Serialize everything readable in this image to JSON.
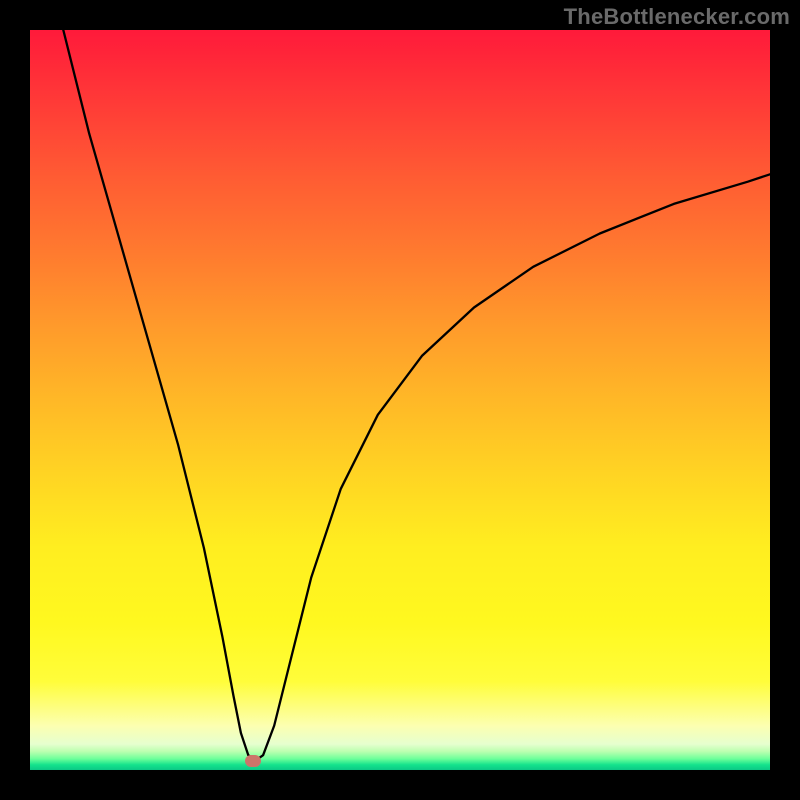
{
  "watermark": "TheBottlenecker.com",
  "marker": {
    "x_pct": 30.1,
    "y_pct": 98.8
  },
  "chart_data": {
    "type": "line",
    "title": "",
    "xlabel": "",
    "ylabel": "",
    "xlim": [
      0,
      100
    ],
    "ylim": [
      0,
      100
    ],
    "series": [
      {
        "name": "curve",
        "x": [
          4.5,
          8,
          12,
          16,
          20,
          23.5,
          26,
          27.5,
          28.5,
          29.5,
          30.5,
          31.5,
          33,
          35,
          38,
          42,
          47,
          53,
          60,
          68,
          77,
          87,
          97,
          100
        ],
        "y": [
          100,
          86,
          72,
          58,
          44,
          30,
          18,
          10,
          5,
          2,
          1.3,
          2,
          6,
          14,
          26,
          38,
          48,
          56,
          62.5,
          68,
          72.5,
          76.5,
          79.5,
          80.5
        ]
      }
    ],
    "background_gradient": {
      "orientation": "vertical",
      "stops": [
        {
          "pos": 0.0,
          "color": "#ff1a3a"
        },
        {
          "pos": 0.5,
          "color": "#ffb827"
        },
        {
          "pos": 0.8,
          "color": "#fff81f"
        },
        {
          "pos": 0.97,
          "color": "#e6ffcf"
        },
        {
          "pos": 1.0,
          "color": "#0bc986"
        }
      ]
    },
    "marker": {
      "x": 30.1,
      "y": 1.2,
      "color": "#cc746a"
    }
  }
}
